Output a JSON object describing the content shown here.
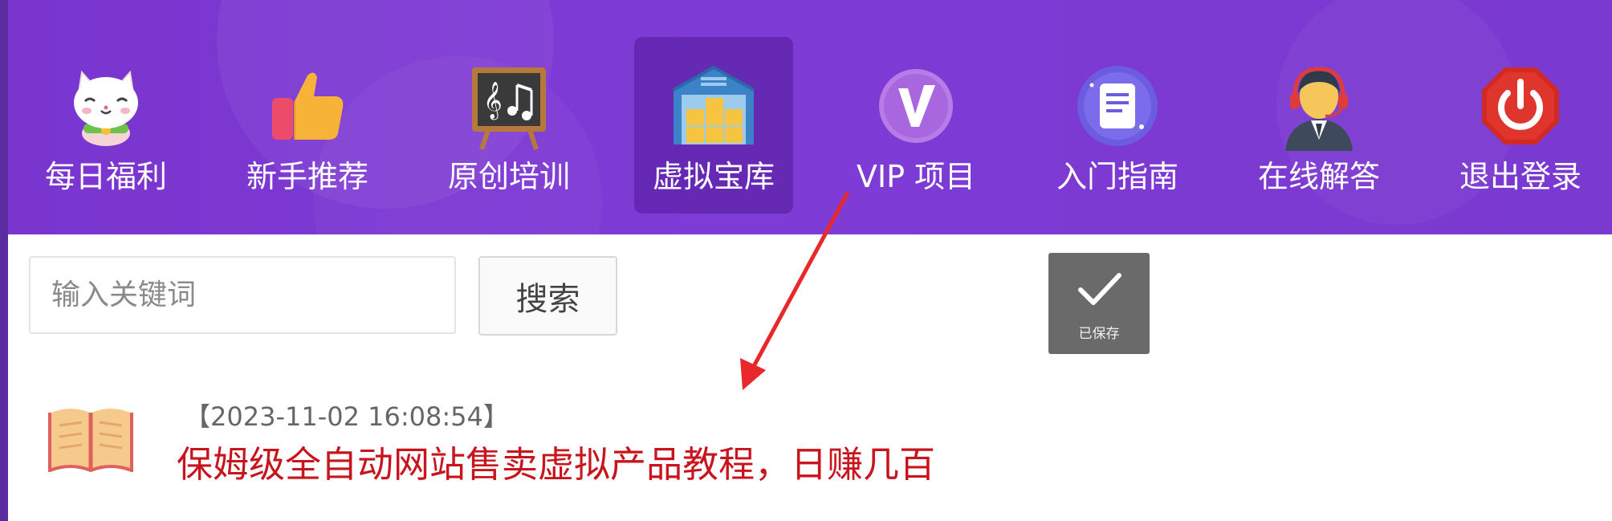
{
  "nav": {
    "items": [
      {
        "label": "每日福利",
        "icon": "lucky-cat-icon"
      },
      {
        "label": "新手推荐",
        "icon": "thumbs-up-icon"
      },
      {
        "label": "原创培训",
        "icon": "music-chalkboard-icon"
      },
      {
        "label": "虚拟宝库",
        "icon": "warehouse-icon"
      },
      {
        "label": "VIP 项目",
        "icon": "vip-badge-icon"
      },
      {
        "label": "入门指南",
        "icon": "document-guide-icon"
      },
      {
        "label": "在线解答",
        "icon": "support-agent-icon"
      },
      {
        "label": "退出登录",
        "icon": "power-off-icon"
      }
    ],
    "active_index": 3
  },
  "search": {
    "placeholder": "输入关键词",
    "button_label": "搜索"
  },
  "toast": {
    "text": "已保存",
    "icon": "checkmark-icon"
  },
  "article": {
    "date": "【2023-11-02 16:08:54】",
    "title": "保姆级全自动网站售卖虚拟产品教程，日赚几百",
    "icon": "open-book-icon"
  },
  "colors": {
    "nav_background": "#7b38cf",
    "active_tile": "#5d25a6",
    "article_title": "#c8141c",
    "annotation_arrow": "#e8282b"
  }
}
